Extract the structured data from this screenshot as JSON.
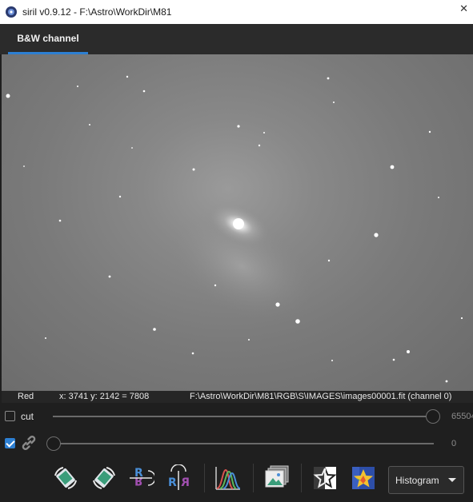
{
  "window": {
    "title": "siril v0.9.12 - F:\\Astro\\WorkDir\\M81"
  },
  "tabs": [
    {
      "label": "B&W channel",
      "active": true
    }
  ],
  "infobar": {
    "channel": "Red",
    "coords": "x: 3741 y: 2142 = 7808",
    "file": "F:\\Astro\\WorkDir\\M81\\RGB\\S\\IMAGES\\images00001.fit (channel 0)"
  },
  "controls": {
    "cut": {
      "label": "cut",
      "checked": false,
      "high_value": "65504"
    },
    "link": {
      "checked": true,
      "low_value": "0"
    }
  },
  "toolbar": {
    "icons": [
      "rotate-left-icon",
      "rotate-right-icon",
      "mirror-x-icon",
      "mirror-y-icon",
      "histogram-curves-icon",
      "image-stack-icon",
      "negative-view-icon",
      "color-palette-icon"
    ],
    "display_mode": "Histogram"
  },
  "colors": {
    "accent": "#2d7fd2",
    "background": "#1f1f1f"
  }
}
